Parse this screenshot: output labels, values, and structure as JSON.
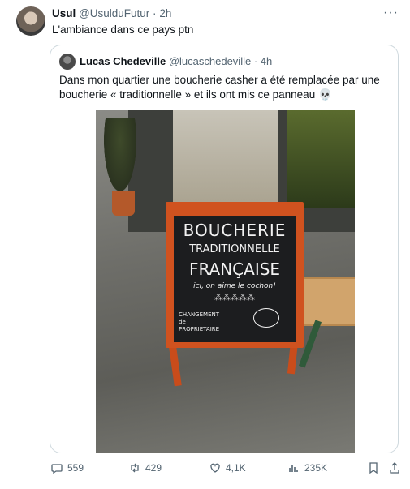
{
  "tweet": {
    "author_name": "Usul",
    "author_handle": "@UsulduFutur",
    "separator": "·",
    "time": "2h",
    "text": "L'ambiance dans ce pays ptn",
    "more_label": "···"
  },
  "quote": {
    "author_name": "Lucas Chedeville",
    "author_handle": "@lucaschedeville",
    "separator": "·",
    "time": "4h",
    "text": "Dans mon quartier une boucherie casher a été remplacée par une boucherie « traditionnelle » et ils ont mis ce panneau 💀"
  },
  "sign": {
    "line1": "BOUCHERIE",
    "line2": "TRADITIONNELLE",
    "line3": "FRANÇAISE",
    "line4": "ici, on aime le cochon!",
    "line5": "⁂⁂⁂⁂⁂",
    "line6a": "CHANGEMENT",
    "line6b": "de",
    "line6c": "PROPRIETAIRE"
  },
  "actions": {
    "replies": "559",
    "reposts": "429",
    "likes": "4,1K",
    "views": "235K"
  },
  "icons": {
    "reply": "reply-icon",
    "repost": "repost-icon",
    "like": "heart-icon",
    "views": "views-icon",
    "bookmark": "bookmark-icon",
    "share": "share-icon"
  }
}
